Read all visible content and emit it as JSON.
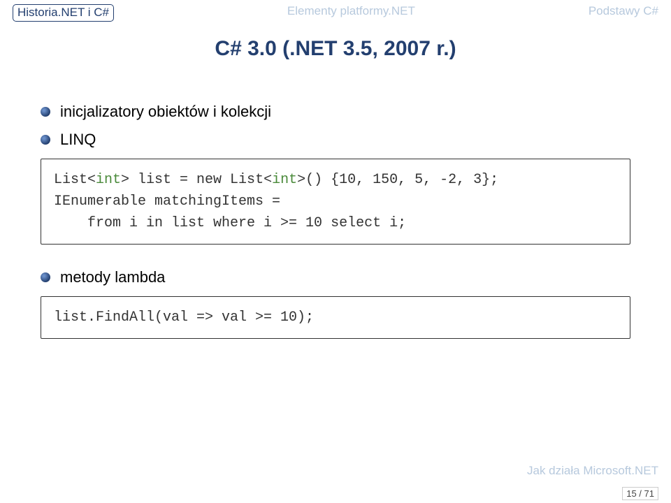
{
  "nav": {
    "left": "Historia.NET i C#",
    "center": "Elementy platformy.NET",
    "right": "Podstawy C#"
  },
  "title": "C# 3.0 (.NET 3.5, 2007 r.)",
  "bullets": {
    "b1": "inicjalizatory obiektów i kolekcji",
    "b2": "LINQ",
    "b3": "metody lambda"
  },
  "code": {
    "block1": {
      "line1a": "List<",
      "line1b": "int",
      "line1c": "> list = new List<",
      "line1d": "int",
      "line1e": ">() {10, 150, 5, -2, 3};",
      "line2": "IEnumerable matchingItems =",
      "line3": "    from i in list where i >= 10 select i;"
    },
    "block2": {
      "line1": "list.FindAll(val => val >= 10);"
    }
  },
  "footer": {
    "talk": "Jak działa Microsoft.NET",
    "page": "15 / 71"
  }
}
